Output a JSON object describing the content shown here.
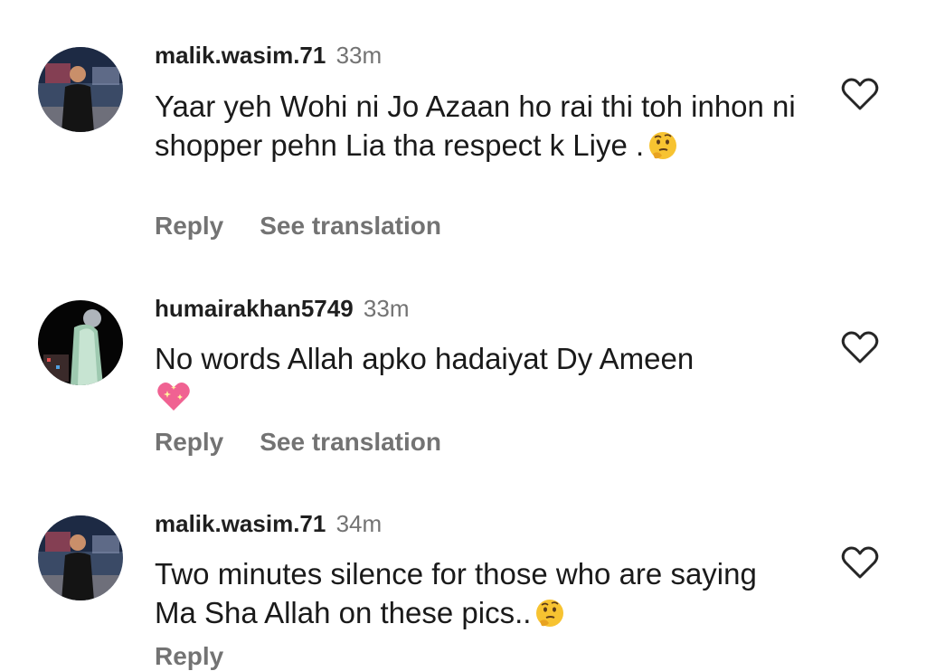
{
  "comments": [
    {
      "username": "malik.wasim.71",
      "time": "33m",
      "text": "Yaar yeh Wohi ni Jo Azaan ho rai thi toh inhon ni shopper pehn Lia tha respect k Liye .",
      "emoji": "thinking-face-emoji",
      "reply_label": "Reply",
      "translate_label": "See translation",
      "like_icon": "heart-outline-icon"
    },
    {
      "username": "humairakhan5749",
      "time": "33m",
      "text": "No words Allah apko hadaiyat Dy Ameen",
      "emoji": "sparkling-heart-emoji",
      "reply_label": "Reply",
      "translate_label": "See translation",
      "like_icon": "heart-outline-icon"
    },
    {
      "username": "malik.wasim.71",
      "time": "34m",
      "text": "Two minutes silence for those who are saying Ma Sha Allah on these pics..",
      "emoji": "thinking-face-emoji",
      "reply_label": "Reply",
      "like_icon": "heart-outline-icon"
    }
  ],
  "colors": {
    "text": "#1a1a1a",
    "muted": "#737373",
    "heart_stroke": "#262626"
  }
}
